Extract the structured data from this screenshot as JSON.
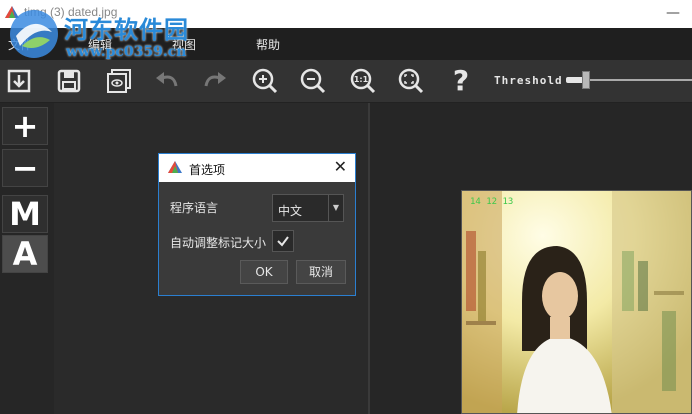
{
  "window": {
    "title": "timg (3) dated.jpg"
  },
  "watermark": {
    "text": "河东软件园",
    "url": "www.pc0359.cn"
  },
  "menubar": {
    "items": [
      "文件",
      "编辑",
      "视图",
      "帮助"
    ]
  },
  "toolbar": {
    "icons": [
      "save-download-icon",
      "save-icon",
      "preview-icon",
      "undo-icon",
      "redo-icon",
      "zoom-in-icon",
      "zoom-out-icon",
      "actual-size-icon",
      "fit-screen-icon",
      "help-icon"
    ],
    "help_label": "?",
    "actual_size_label": "1:1",
    "threshold_label": "Threshold",
    "threshold_value": 0.15
  },
  "sidebar": {
    "buttons": [
      "+",
      "−",
      "M",
      "A"
    ],
    "active": "A"
  },
  "photo": {
    "date_stamp": "14 12 13"
  },
  "dialog": {
    "title": "首选项",
    "language_label": "程序语言",
    "language_value": "中文",
    "auto_resize_label": "自动调整标记大小",
    "auto_resize_checked": true,
    "ok_label": "OK",
    "cancel_label": "取消"
  },
  "colors": {
    "accent": "#2b7fd0",
    "background": "#2b2b2b",
    "toolbar": "#333333"
  }
}
